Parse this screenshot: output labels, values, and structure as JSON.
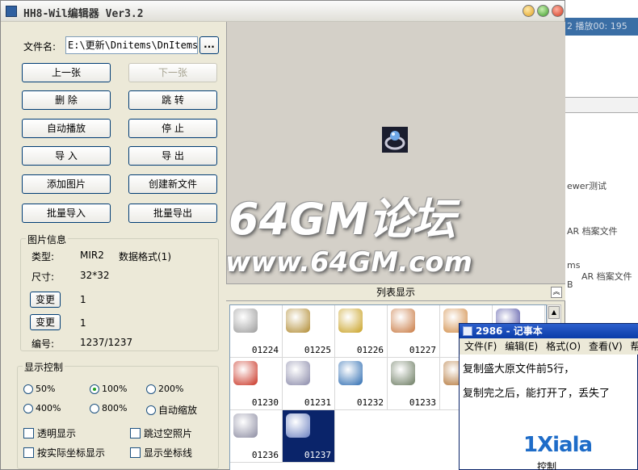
{
  "window": {
    "title": "HH8-Wil编辑器 Ver3.2"
  },
  "file": {
    "label": "文件名:",
    "value": "E:\\更新\\Dnitems\\DnItems.",
    "browse_label": "..."
  },
  "buttons": {
    "prev": "上一张",
    "next": "下一张",
    "delete": "删  除",
    "jump": "跳  转",
    "autoplay": "自动播放",
    "stop": "停  止",
    "import": "导  入",
    "export": "导  出",
    "add_image": "添加图片",
    "new_file": "创建新文件",
    "batch_import": "批量导入",
    "batch_export": "批量导出"
  },
  "image_info": {
    "legend": "图片信息",
    "type_label": "类型:",
    "type_value": "MIR2",
    "format_value": "数据格式(1)",
    "size_label": "尺寸:",
    "size_value": "32*32",
    "change_label": "变更",
    "change1_value": "1",
    "change2_value": "1",
    "index_label": "编号:",
    "index_value": "1237/1237"
  },
  "display_control": {
    "legend": "显示控制",
    "zoom_options": [
      {
        "label": "50%",
        "selected": false
      },
      {
        "label": "100%",
        "selected": true
      },
      {
        "label": "200%",
        "selected": false
      },
      {
        "label": "400%",
        "selected": false
      },
      {
        "label": "800%",
        "selected": false
      },
      {
        "label": "自动缩放",
        "selected": false
      }
    ],
    "checkboxes": [
      "透明显示",
      "跳过空照片",
      "按实际坐标显示",
      "显示坐标线"
    ]
  },
  "watermark": {
    "line1": "64GM论坛",
    "line2": "www.64GM.com"
  },
  "list": {
    "header": "列表显示",
    "collapse_icon": "chevron-up-icon",
    "items": [
      {
        "num": "01224",
        "color": "#9a9a9a"
      },
      {
        "num": "01225",
        "color": "#b08a30"
      },
      {
        "num": "01226",
        "color": "#c8a020"
      },
      {
        "num": "01227",
        "color": "#c87840"
      },
      {
        "num": "",
        "color": "#d08840"
      },
      {
        "num": "",
        "color": "#4a4aa0"
      },
      {
        "num": "01230",
        "color": "#c83020"
      },
      {
        "num": "01231",
        "color": "#8888a8"
      },
      {
        "num": "01232",
        "color": "#2a6ab0"
      },
      {
        "num": "01233",
        "color": "#6a7a60"
      },
      {
        "num": "",
        "color": "#b07030"
      },
      {
        "num": "01236",
        "color": "#8a8aa0"
      },
      {
        "num": "01237",
        "color": "#6a80c0"
      }
    ]
  },
  "notepad": {
    "title": "2986 - 记事本",
    "menu": [
      "文件(F)",
      "编辑(E)",
      "格式(O)",
      "查看(V)",
      "帮"
    ],
    "line1": "复制盛大原文件前5行，",
    "line2": "复制完之后，能打开了，丢失了",
    "footer": "控制"
  },
  "background": {
    "topbar_text": "2 播放00: 195",
    "lines": [
      "ewer测试",
      "AR 档案文件",
      "ms",
      "B",
      "AR 档案文件"
    ]
  },
  "logo": "1Xiala"
}
